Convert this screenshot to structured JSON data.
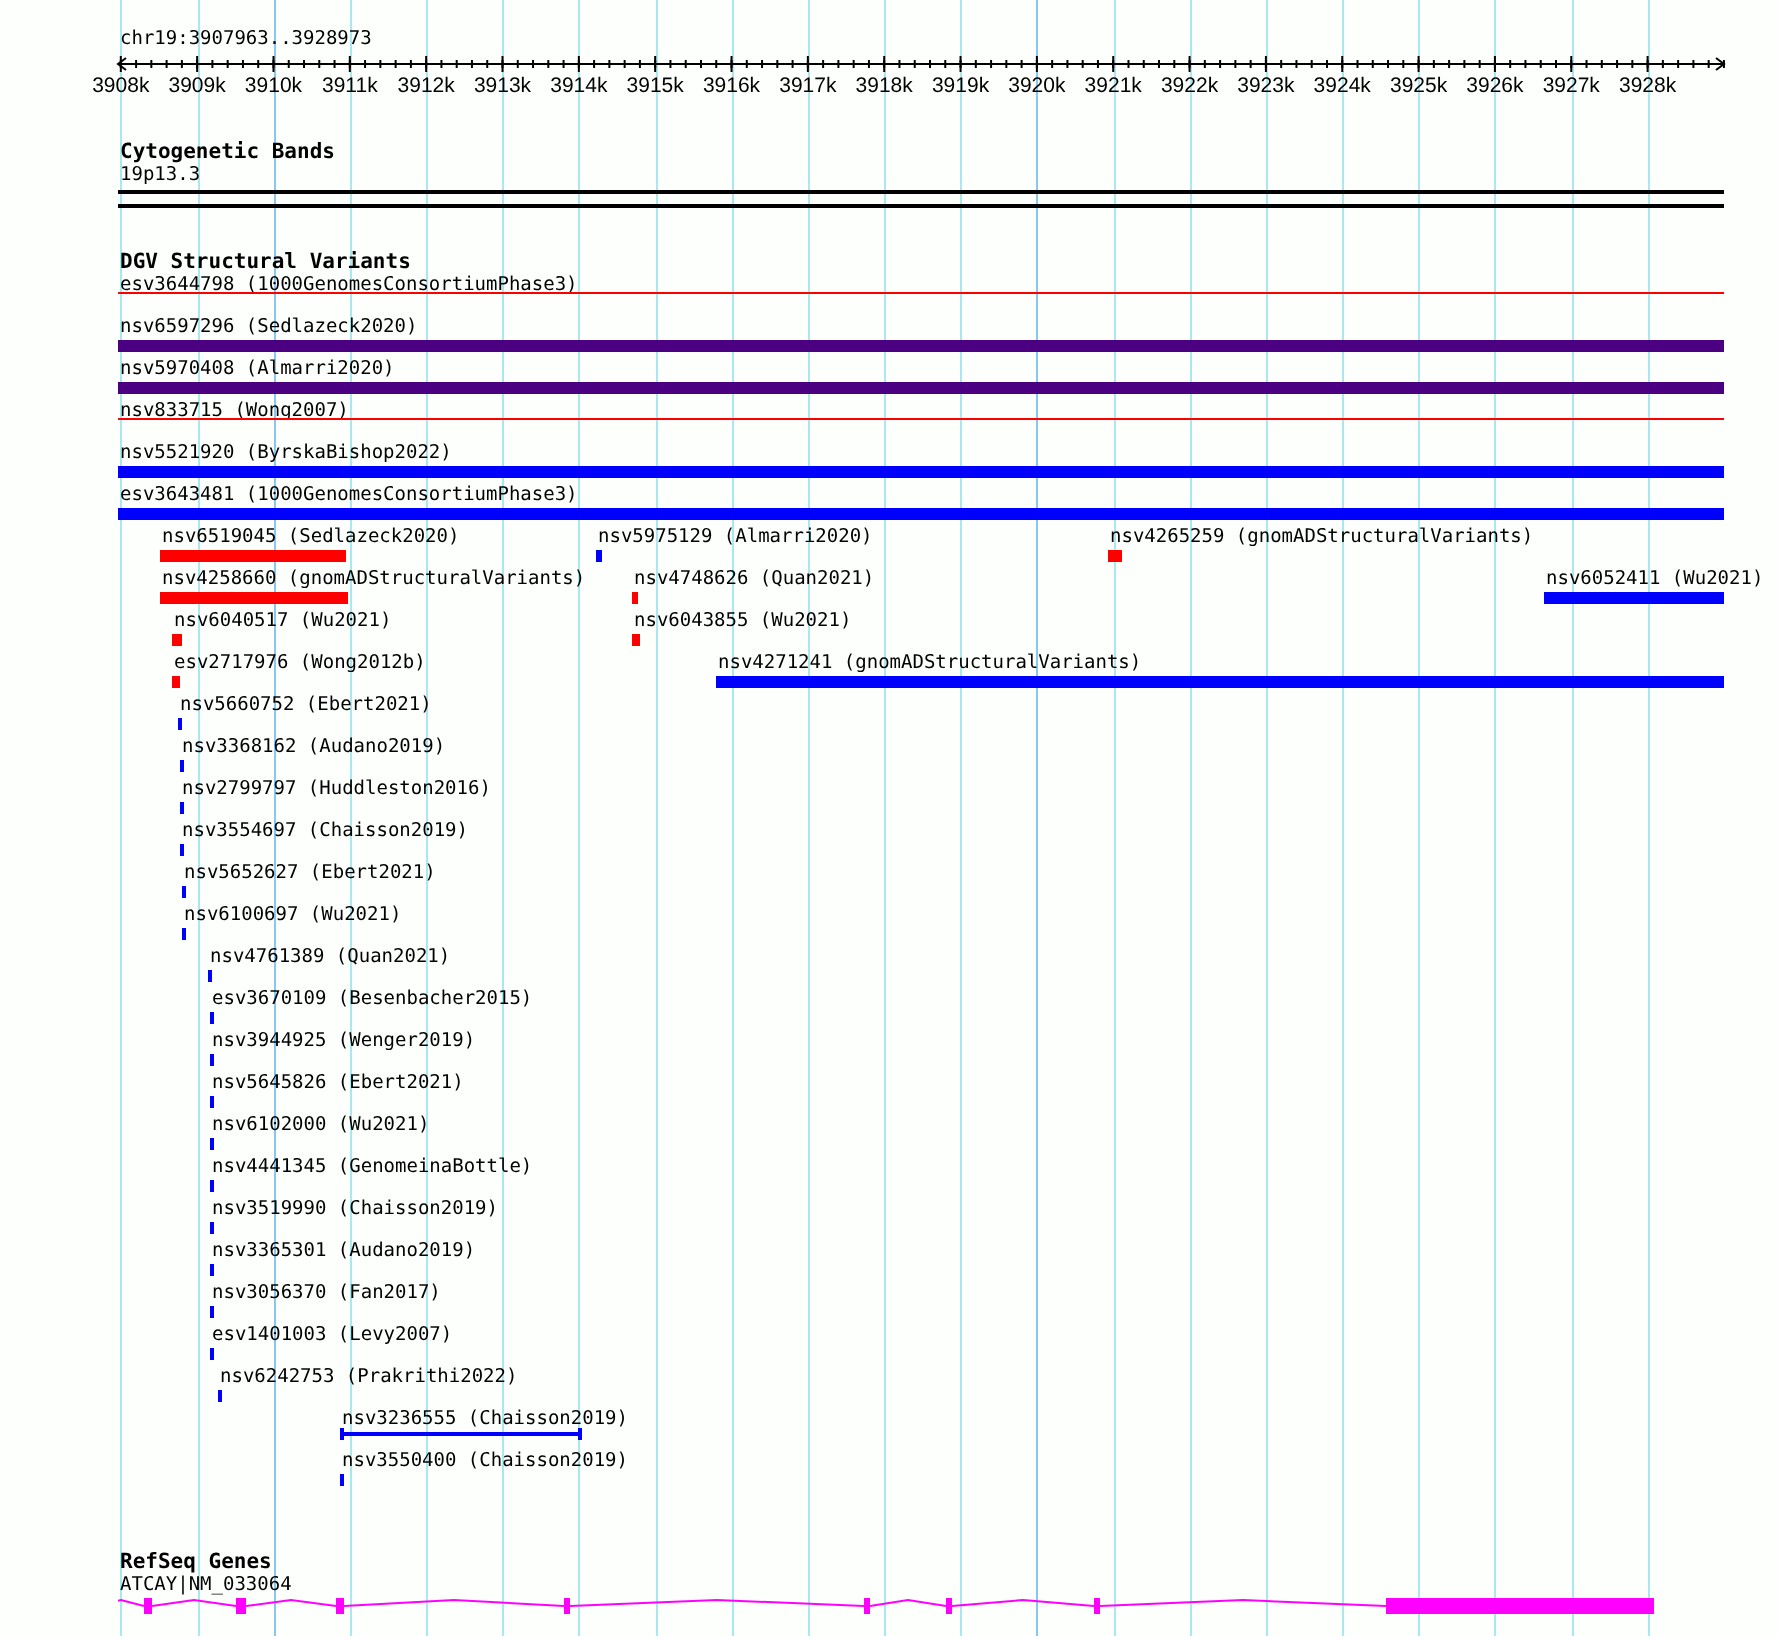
{
  "location": "chr19:3907963..3928973",
  "ruler": {
    "ticks": [
      "3908k",
      "3909k",
      "3910k",
      "3911k",
      "3912k",
      "3913k",
      "3914k",
      "3915k",
      "3916k",
      "3917k",
      "3918k",
      "3919k",
      "3920k",
      "3921k",
      "3922k",
      "3923k",
      "3924k",
      "3925k",
      "3926k",
      "3927k",
      "3928k"
    ]
  },
  "tracks": [
    {
      "kind": "cytoband",
      "title": "Cytogenetic Bands",
      "band": "19p13.3"
    },
    {
      "kind": "variants",
      "title": "DGV Structural Variants",
      "rows": [
        [
          {
            "label": "esv3644798 (1000GenomesConsortiumPhase3)",
            "color": "#ff0000",
            "kind": "line"
          }
        ],
        [
          {
            "label": "nsv6597296 (Sedlazeck2020)",
            "color": "#4b0082",
            "kind": "bar"
          }
        ],
        [
          {
            "label": "nsv5970408 (Almarri2020)",
            "color": "#4b0082",
            "kind": "bar"
          }
        ],
        [
          {
            "label": "nsv833715 (Wong2007)",
            "color": "#ff0000",
            "kind": "line"
          }
        ],
        [
          {
            "label": "nsv5521920 (ByrskaBishop2022)",
            "color": "#0000ff",
            "kind": "bar"
          }
        ],
        [
          {
            "label": "esv3643481 (1000GenomesConsortiumPhase3)",
            "color": "#0000ff",
            "kind": "bar"
          }
        ],
        [
          {
            "label": "nsv6519045 (Sedlazeck2020)",
            "color": "#ff0000",
            "kind": "bar"
          },
          {
            "label": "nsv5975129 (Almarri2020)",
            "color": "#0000ff",
            "kind": "bar"
          },
          {
            "label": "nsv4265259 (gnomADStructuralVariants)",
            "color": "#ff0000",
            "kind": "bar"
          }
        ],
        [
          {
            "label": "nsv4258660 (gnomADStructuralVariants)",
            "color": "#ff0000",
            "kind": "bar"
          },
          {
            "label": "nsv4748626 (Quan2021)",
            "color": "#ff0000",
            "kind": "bar"
          },
          {
            "label": "nsv6052411 (Wu2021)",
            "color": "#0000ff",
            "kind": "bar"
          }
        ],
        [
          {
            "label": "nsv6040517 (Wu2021)",
            "color": "#ff0000",
            "kind": "bar"
          },
          {
            "label": "nsv6043855 (Wu2021)",
            "color": "#ff0000",
            "kind": "bar"
          }
        ],
        [
          {
            "label": "esv2717976 (Wong2012b)",
            "color": "#ff0000",
            "kind": "bar"
          },
          {
            "label": "nsv4271241 (gnomADStructuralVariants)",
            "color": "#0000ff",
            "kind": "bar"
          }
        ],
        [
          {
            "label": "nsv5660752 (Ebert2021)",
            "color": "#0000ff",
            "kind": "bar"
          }
        ],
        [
          {
            "label": "nsv3368162 (Audano2019)",
            "color": "#0000ff",
            "kind": "bar"
          }
        ],
        [
          {
            "label": "nsv2799797 (Huddleston2016)",
            "color": "#0000ff",
            "kind": "bar"
          }
        ],
        [
          {
            "label": "nsv3554697 (Chaisson2019)",
            "color": "#0000ff",
            "kind": "bar"
          }
        ],
        [
          {
            "label": "nsv5652627 (Ebert2021)",
            "color": "#0000ff",
            "kind": "bar"
          }
        ],
        [
          {
            "label": "nsv6100697 (Wu2021)",
            "color": "#0000ff",
            "kind": "bar"
          }
        ],
        [
          {
            "label": "nsv4761389 (Quan2021)",
            "color": "#0000ff",
            "kind": "bar"
          }
        ],
        [
          {
            "label": "esv3670109 (Besenbacher2015)",
            "color": "#0000ff",
            "kind": "bar"
          }
        ],
        [
          {
            "label": "nsv3944925 (Wenger2019)",
            "color": "#0000ff",
            "kind": "bar"
          }
        ],
        [
          {
            "label": "nsv5645826 (Ebert2021)",
            "color": "#0000ff",
            "kind": "bar"
          }
        ],
        [
          {
            "label": "nsv6102000 (Wu2021)",
            "color": "#0000ff",
            "kind": "bar"
          }
        ],
        [
          {
            "label": "nsv4441345 (GenomeinaBottle)",
            "color": "#0000ff",
            "kind": "bar"
          }
        ],
        [
          {
            "label": "nsv3519990 (Chaisson2019)",
            "color": "#0000ff",
            "kind": "bar"
          }
        ],
        [
          {
            "label": "nsv3365301 (Audano2019)",
            "color": "#0000ff",
            "kind": "bar"
          }
        ],
        [
          {
            "label": "nsv3056370 (Fan2017)",
            "color": "#0000ff",
            "kind": "bar"
          }
        ],
        [
          {
            "label": "esv1401003 (Levy2007)",
            "color": "#0000ff",
            "kind": "bar"
          }
        ],
        [
          {
            "label": "nsv6242753 (Prakrithi2022)",
            "color": "#0000ff",
            "kind": "bar"
          }
        ],
        [
          {
            "label": "nsv3236555 (Chaisson2019)",
            "color": "#0000ff",
            "kind": "span"
          }
        ],
        [
          {
            "label": "nsv3550400 (Chaisson2019)",
            "color": "#0000ff",
            "kind": "bar"
          }
        ]
      ]
    },
    {
      "kind": "genes",
      "title": "RefSeq Genes",
      "gene": {
        "label": "ATCAY|NM_033064"
      }
    }
  ]
}
